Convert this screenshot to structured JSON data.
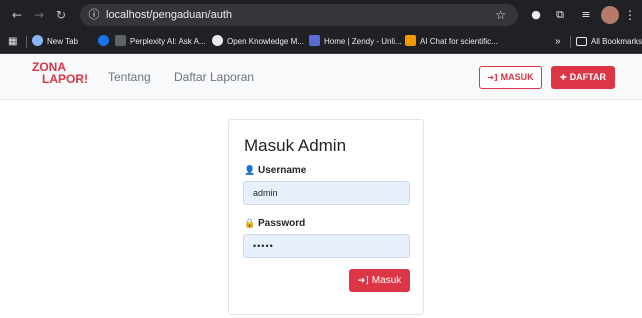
{
  "browser": {
    "url": "localhost/pengaduan/auth",
    "bookmarks": [
      {
        "label": "New Tab",
        "color": "#8ab4f8"
      },
      {
        "label": "",
        "color": "#1a73e8"
      },
      {
        "label": "Perplexity AI: Ask A...",
        "color": "#3c4043"
      },
      {
        "label": "Open Knowledge M...",
        "color": "#e8eaed"
      },
      {
        "label": "Home | Zendy - Unli...",
        "color": "#5b6bd6"
      },
      {
        "label": "AI Chat for scientific...",
        "color": "#f29900"
      }
    ],
    "more_label": "»",
    "all_bookmarks": "All Bookmarks"
  },
  "navbar": {
    "brand_line1": "ZONA",
    "brand_line2": "LAPOR!",
    "links": [
      "Tentang",
      "Daftar Laporan"
    ],
    "login_button": "MASUK",
    "register_button": "DAFTAR"
  },
  "login": {
    "title": "Masuk Admin",
    "username_label": "Username",
    "username_value": "admin",
    "password_label": "Password",
    "password_value": "•••••",
    "submit_label": "Masuk"
  },
  "colors": {
    "brand_red": "#dc3545",
    "input_fill": "#e8f0fe"
  },
  "icons": {
    "user": "user-icon",
    "lock": "lock-icon",
    "login": "sign-in-icon",
    "register": "user-plus-icon"
  }
}
